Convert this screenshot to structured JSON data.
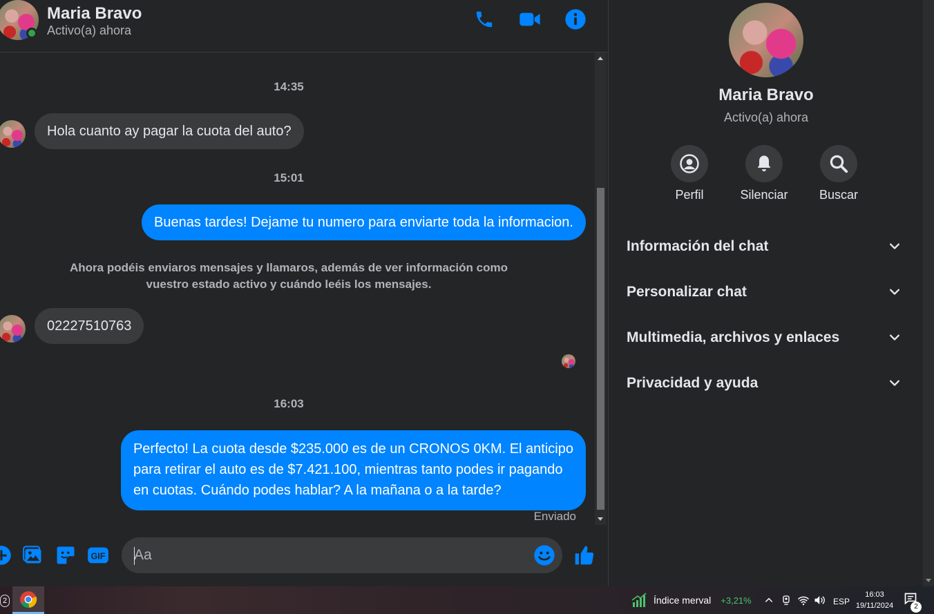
{
  "header": {
    "contact_name": "Maria Bravo",
    "status": "Activo(a) ahora",
    "actions": [
      "phone-icon",
      "video-icon",
      "info-icon"
    ]
  },
  "colors": {
    "accent": "#0084ff",
    "background": "#242526",
    "bubble_incoming": "#3a3b3c",
    "online": "#31a24c"
  },
  "conversation": {
    "time_1": "14:35",
    "msg_1": "Hola cuanto ay pagar la cuota del auto?",
    "time_2": "15:01",
    "msg_2": "Buenas tardes! Dejame tu numero para enviarte toda la informacion.",
    "system_note_line1": "Ahora podéis enviaros mensajes y llamaros, además de ver información como",
    "system_note_line2": "vuestro estado activo y cuándo leéis los mensajes.",
    "msg_3": "02227510763",
    "time_3": "16:03",
    "msg_4_line1": "Perfecto! La cuota desde $235.000 es de un CRONOS 0KM. El anticipo",
    "msg_4_line2": "para retirar el auto es de $7.421.100, mientras tanto podes ir pagando",
    "msg_4_line3": "en cuotas. Cuándo podes hablar? A la mañana o a la tarde?",
    "delivery_status": "Enviado"
  },
  "composer": {
    "placeholder": "Aa",
    "buttons": [
      "plus-icon",
      "image-icon",
      "sticker-icon",
      "gif-icon",
      "emoji-icon",
      "like-icon"
    ],
    "gif_label": "GIF"
  },
  "panel": {
    "name": "Maria Bravo",
    "status": "Activo(a) ahora",
    "actions": [
      {
        "label": "Perfil",
        "icon": "profile-icon"
      },
      {
        "label": "Silenciar",
        "icon": "bell-icon"
      },
      {
        "label": "Buscar",
        "icon": "search-icon"
      }
    ],
    "sections": [
      {
        "label": "Información del chat"
      },
      {
        "label": "Personalizar chat"
      },
      {
        "label": "Multimedia, archivos y enlaces"
      },
      {
        "label": "Privacidad y ayuda"
      }
    ]
  },
  "taskbar": {
    "left_badge": "2",
    "stock_name": "Índice merval",
    "stock_change": "+3,21%",
    "language": "ESP",
    "time": "16:03",
    "date": "19/11/2024",
    "notification_count": "2"
  }
}
